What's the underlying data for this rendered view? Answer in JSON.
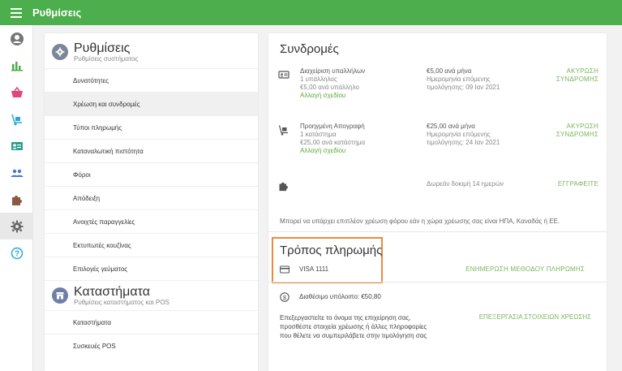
{
  "topbar": {
    "title": "Ρυθμίσεις"
  },
  "colors": {
    "brand_green": "#4cae4c",
    "link_green": "#5aa83d",
    "highlight_orange": "#ea8b3f"
  },
  "sidebar": {
    "items": [
      {
        "icon": "user-circle-icon",
        "color": "#777777"
      },
      {
        "icon": "bar-chart-icon",
        "color": "#4cae4c"
      },
      {
        "icon": "basket-icon",
        "color": "#e2457a"
      },
      {
        "icon": "dolly-icon",
        "color": "#2aa7d6"
      },
      {
        "icon": "id-card-icon",
        "color": "#2a9d8f"
      },
      {
        "icon": "people-icon",
        "color": "#4a74d1"
      },
      {
        "icon": "puzzle-icon",
        "color": "#8a5a44"
      },
      {
        "icon": "gear-icon",
        "color": "#666666"
      },
      {
        "icon": "help-icon",
        "color": "#2aa7d6"
      }
    ]
  },
  "settings": {
    "title": "Ρυθμίσεις",
    "subtitle": "Ρυθμίσεις συστήματος",
    "items": [
      "Δυνατότητες",
      "Χρέωση και συνδρομές",
      "Τύποι πληρωμής",
      "Καταναλωτική πιστότητα",
      "Φόροι",
      "Απόδειξη",
      "Ανοιχτές παραγγελίες",
      "Εκτυπωτές κουζίνας",
      "Επιλογές γεύματος"
    ],
    "selected_index": 1
  },
  "stores": {
    "title": "Καταστήματα",
    "subtitle": "Ρυθμίσεις καταστήματος και POS",
    "items": [
      "Καταστήματα",
      "Συσκευές POS"
    ]
  },
  "subscriptions": {
    "title": "Συνδρομές",
    "rows": [
      {
        "icon": "id-badge-icon",
        "name": "Διαχείριση υπαλλήλων",
        "count": "1 υπάλληλος",
        "unit_price": "€5,00 ανά υπάλληλο",
        "change_link": "Αλλαγή σχεδίου",
        "price": "€5,00 ανά μήνα",
        "next_label": "Ημερομηνία επόμενης",
        "next_date": "τιμολόγησης: 09 Ιαν 2021",
        "action_line1": "ΑΚΥΡΩΣΗ",
        "action_line2": "ΣΥΝΔΡΟΜΗΣ"
      },
      {
        "icon": "dolly-icon",
        "name": "Προηγμένη Απογραφή",
        "count": "1 κατάστημα",
        "unit_price": "€25,00 ανά κατάστημα",
        "change_link": "Αλλαγή σχεδίου",
        "price": "€25,00 ανά μήνα",
        "next_label": "Ημερομηνία επόμενης",
        "next_date": "τιμολόγησης: 24 Ιαν 2021",
        "action_line1": "ΑΚΥΡΩΣΗ",
        "action_line2": "ΣΥΝΔΡΟΜΗΣ"
      }
    ],
    "trial": {
      "icon": "puzzle-icon",
      "text": "Δωρεάν δοκιμή 14 ημερών",
      "action": "ΕΓΓΡΑΦΕΙΤΕ"
    },
    "tax_note": "Μπορεί να υπάρχει επιπλέον χρέωση φόρου εάν η χώρα χρέωσης σας είναι ΗΠΑ, Καναδάς ή ΕΕ."
  },
  "payment": {
    "title": "Τρόπος πληρωμής",
    "card_label": "VISA 1111",
    "update_action": "ΕΝΗΜΕΡΩΣΗ ΜΕΘΟΔΟΥ ΠΛΗΡΩΜΗΣ",
    "balance": "Διαθέσιμο υπόλοιπο: €50,80",
    "billing_text": "Επεξεργαστείτε το όνομα της επιχείρηση σας, προσθέστε στοιχεία χρέωσης ή άλλες πληροφορίες που θέλετε να συμπεριλάβετε στην τιμολόγηση σας",
    "billing_action": "ΕΠΕΞΕΡΓΑΣΙΑ ΣΤΟΙΧΕΙΩΝ ΧΡΕΩΣΗΣ"
  }
}
